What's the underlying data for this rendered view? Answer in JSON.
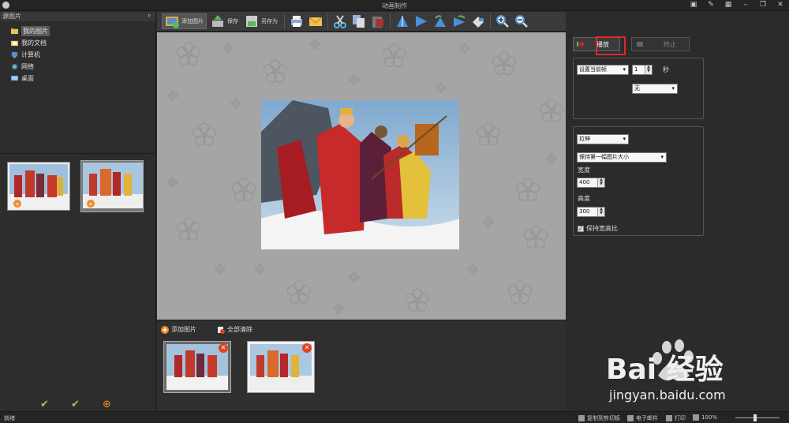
{
  "window": {
    "title": "动画制作"
  },
  "left_panel": {
    "header": "源图片",
    "pin_glyph": "ᵖ",
    "tree": [
      {
        "label": "我的图片",
        "icon": "pictures-folder-icon",
        "selected": true
      },
      {
        "label": "我的文档",
        "icon": "documents-folder-icon",
        "selected": false
      },
      {
        "label": "计算机",
        "icon": "computer-icon",
        "selected": false
      },
      {
        "label": "网络",
        "icon": "network-icon",
        "selected": false
      },
      {
        "label": "桌面",
        "icon": "desktop-icon",
        "selected": false
      }
    ]
  },
  "toolbar": {
    "add_image": "添加图片",
    "save": "保存",
    "save_as": "另存为"
  },
  "strip": {
    "add_image": "添加图片",
    "clear_all": "全部清除"
  },
  "right_panel": {
    "play": "播放",
    "stop": "终止",
    "frame_setting": "设置当前帧",
    "frame_value": "1",
    "seconds_unit": "秒",
    "transition": "无",
    "resize_mode": "拉伸",
    "size_mode": "保持第一幅图片大小",
    "width_label": "宽度",
    "width_value": "400",
    "height_label": "高度",
    "height_value": "300",
    "keep_ratio": "保持宽高比"
  },
  "statusbar": {
    "ready": "就绪",
    "copy_clipboard": "复制到剪切板",
    "email": "电子邮件",
    "print": "打印",
    "zoom": "100%"
  },
  "watermark": {
    "brand": "Bai 经验",
    "url": "jingyan.baidu.com"
  },
  "colors": {
    "accent_red": "#e0282b",
    "close_orange": "#e3431d",
    "add_orange": "#f08a24"
  }
}
